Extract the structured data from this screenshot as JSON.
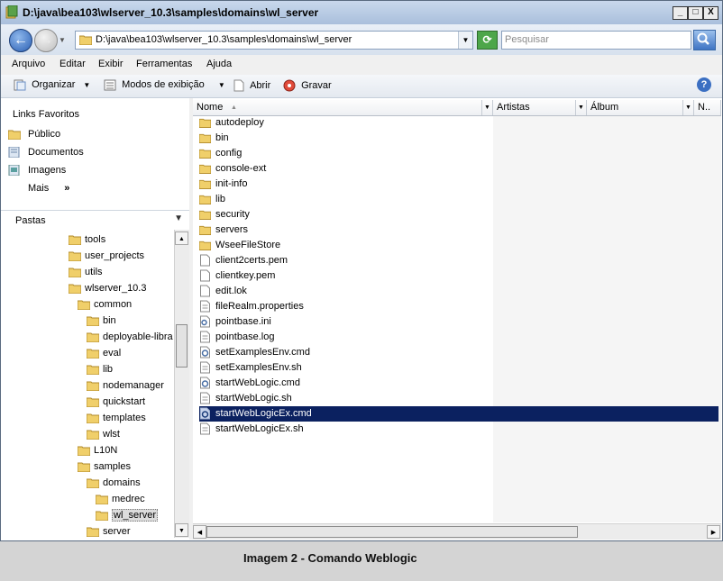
{
  "window": {
    "title": "D:\\java\\bea103\\wlserver_10.3\\samples\\domains\\wl_server",
    "controls": [
      "_",
      "□",
      "X"
    ]
  },
  "address": {
    "path": "D:\\java\\bea103\\wlserver_10.3\\samples\\domains\\wl_server",
    "search_placeholder": "Pesquisar"
  },
  "menu": [
    "Arquivo",
    "Editar",
    "Exibir",
    "Ferramentas",
    "Ajuda"
  ],
  "toolbar": {
    "organize": "Organizar",
    "views": "Modos de exibição",
    "open": "Abrir",
    "burn": "Gravar",
    "help": "?"
  },
  "favorites": {
    "title": "Links Favoritos",
    "items": [
      "Público",
      "Documentos",
      "Imagens"
    ],
    "more": "Mais",
    "more_arrow": "»"
  },
  "folders_header": "Pastas",
  "tree": [
    "tools",
    "user_projects",
    "utils",
    "wlserver_10.3",
    "common",
    "bin",
    "deployable-libra",
    "eval",
    "lib",
    "nodemanager",
    "quickstart",
    "templates",
    "wlst",
    "L10N",
    "samples",
    "domains",
    "medrec",
    "wl_server",
    "server"
  ],
  "columns": [
    "Nome",
    "Artistas",
    "Álbum",
    "N.."
  ],
  "files": [
    {
      "name": "autodeploy",
      "icon": "folder-icon"
    },
    {
      "name": "bin",
      "icon": "folder-icon"
    },
    {
      "name": "config",
      "icon": "folder-icon"
    },
    {
      "name": "console-ext",
      "icon": "folder-icon"
    },
    {
      "name": "init-info",
      "icon": "folder-icon"
    },
    {
      "name": "lib",
      "icon": "folder-icon"
    },
    {
      "name": "security",
      "icon": "folder-icon"
    },
    {
      "name": "servers",
      "icon": "folder-icon"
    },
    {
      "name": "WseeFileStore",
      "icon": "folder-icon"
    },
    {
      "name": "client2certs.pem",
      "icon": "document-icon"
    },
    {
      "name": "clientkey.pem",
      "icon": "document-icon"
    },
    {
      "name": "edit.lok",
      "icon": "document-icon"
    },
    {
      "name": "fileRealm.properties",
      "icon": "text-file-icon"
    },
    {
      "name": "pointbase.ini",
      "icon": "settings-file-icon"
    },
    {
      "name": "pointbase.log",
      "icon": "text-file-icon"
    },
    {
      "name": "setExamplesEnv.cmd",
      "icon": "cmd-file-icon"
    },
    {
      "name": "setExamplesEnv.sh",
      "icon": "text-file-icon"
    },
    {
      "name": "startWebLogic.cmd",
      "icon": "cmd-file-icon"
    },
    {
      "name": "startWebLogic.sh",
      "icon": "text-file-icon"
    },
    {
      "name": "startWebLogicEx.cmd",
      "icon": "cmd-file-icon"
    },
    {
      "name": "startWebLogicEx.sh",
      "icon": "text-file-icon"
    }
  ],
  "caption": "Imagem 2 - Comando Weblogic"
}
